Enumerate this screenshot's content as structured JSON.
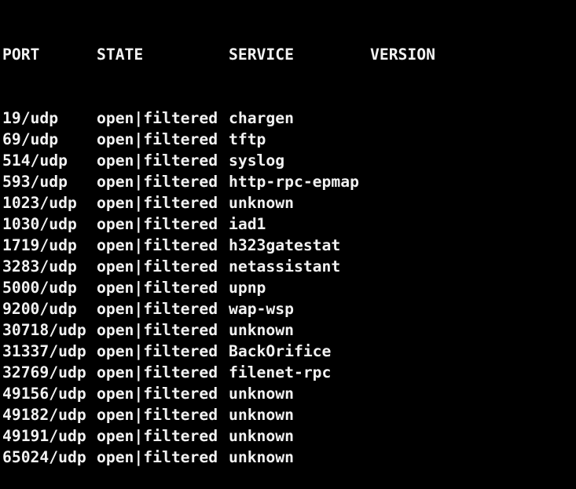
{
  "colors": {
    "background": "#000000",
    "text": "#f2f2f2"
  },
  "header": {
    "port": "PORT",
    "state": "STATE",
    "service": "SERVICE",
    "version": "VERSION"
  },
  "rows": [
    {
      "port": "19/udp",
      "state": "open|filtered",
      "service": "chargen"
    },
    {
      "port": "69/udp",
      "state": "open|filtered",
      "service": "tftp"
    },
    {
      "port": "514/udp",
      "state": "open|filtered",
      "service": "syslog"
    },
    {
      "port": "593/udp",
      "state": "open|filtered",
      "service": "http-rpc-epmap"
    },
    {
      "port": "1023/udp",
      "state": "open|filtered",
      "service": "unknown"
    },
    {
      "port": "1030/udp",
      "state": "open|filtered",
      "service": "iad1"
    },
    {
      "port": "1719/udp",
      "state": "open|filtered",
      "service": "h323gatestat"
    },
    {
      "port": "3283/udp",
      "state": "open|filtered",
      "service": "netassistant"
    },
    {
      "port": "5000/udp",
      "state": "open|filtered",
      "service": "upnp"
    },
    {
      "port": "9200/udp",
      "state": "open|filtered",
      "service": "wap-wsp"
    },
    {
      "port": "30718/udp",
      "state": "open|filtered",
      "service": "unknown"
    },
    {
      "port": "31337/udp",
      "state": "open|filtered",
      "service": "BackOrifice"
    },
    {
      "port": "32769/udp",
      "state": "open|filtered",
      "service": "filenet-rpc"
    },
    {
      "port": "49156/udp",
      "state": "open|filtered",
      "service": "unknown"
    },
    {
      "port": "49182/udp",
      "state": "open|filtered",
      "service": "unknown"
    },
    {
      "port": "49191/udp",
      "state": "open|filtered",
      "service": "unknown"
    },
    {
      "port": "65024/udp",
      "state": "open|filtered",
      "service": "unknown"
    }
  ]
}
